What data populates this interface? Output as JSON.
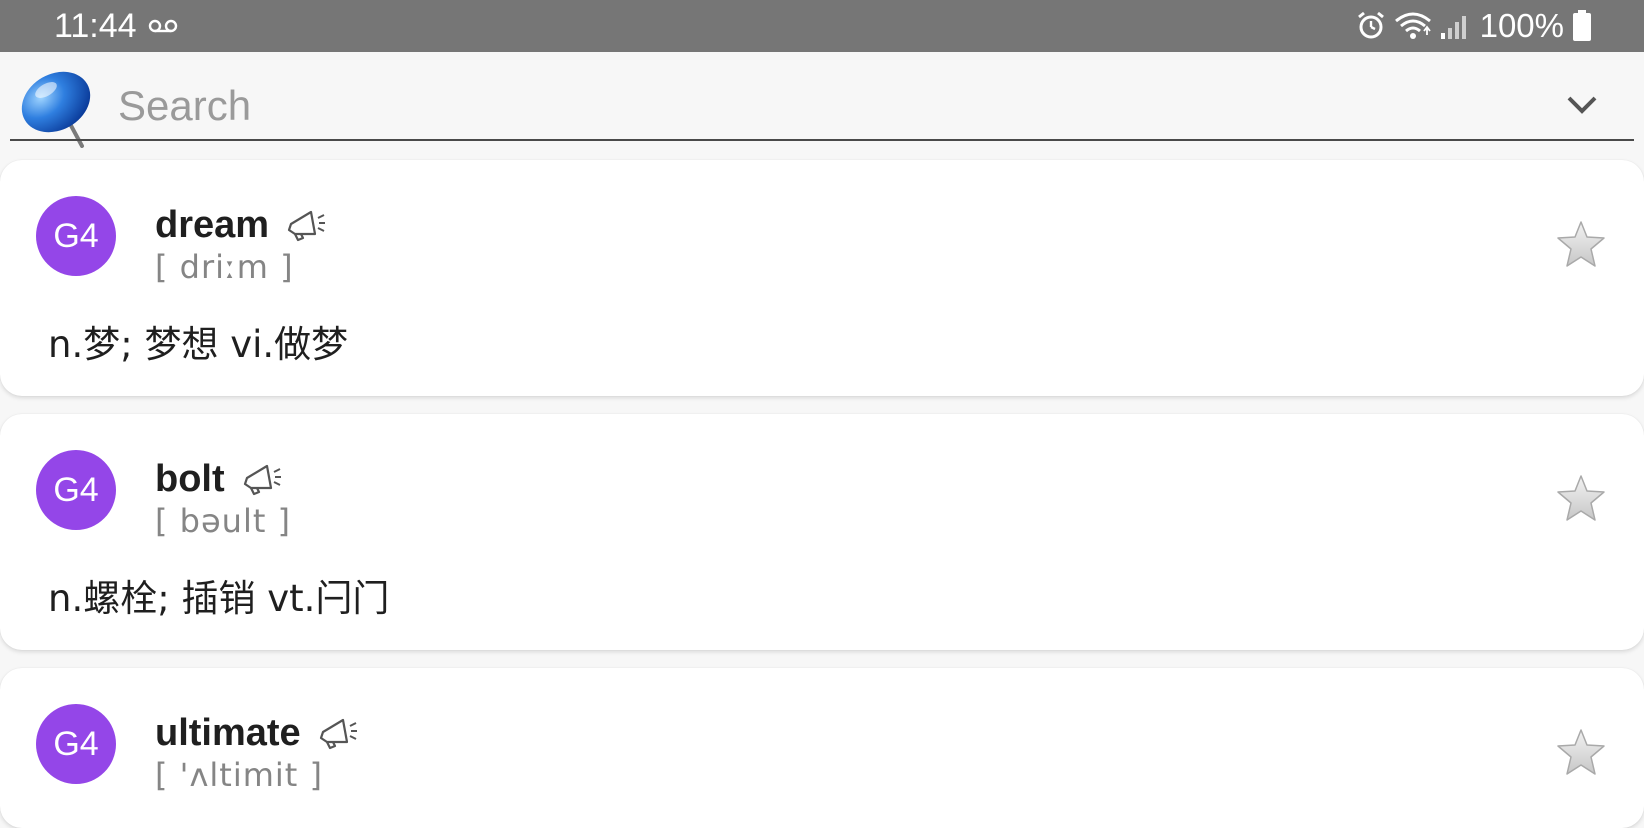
{
  "status_bar": {
    "time": "11:44",
    "battery": "100%",
    "icons": [
      "voicemail-icon",
      "alarm-icon",
      "wifi-icon",
      "cell-signal-icon",
      "battery-icon"
    ]
  },
  "search": {
    "placeholder": "Search",
    "value": "",
    "logo": "pushpin-icon",
    "dropdown": "chevron-down-icon"
  },
  "words": [
    {
      "level": "G4",
      "word": "dream",
      "phonetic": "[ driːm ]",
      "meaning": "n.梦; 梦想 vi.做梦"
    },
    {
      "level": "G4",
      "word": "bolt",
      "phonetic": "[ bəult ]",
      "meaning": "n.螺栓; 插销 vt.闩门"
    },
    {
      "level": "G4",
      "word": "ultimate",
      "phonetic": "[ 'ʌltimit ]",
      "meaning": ""
    }
  ],
  "colors": {
    "status_bar": "#767676",
    "badge": "#9446e8",
    "background": "#f7f7f7",
    "card": "#ffffff"
  }
}
